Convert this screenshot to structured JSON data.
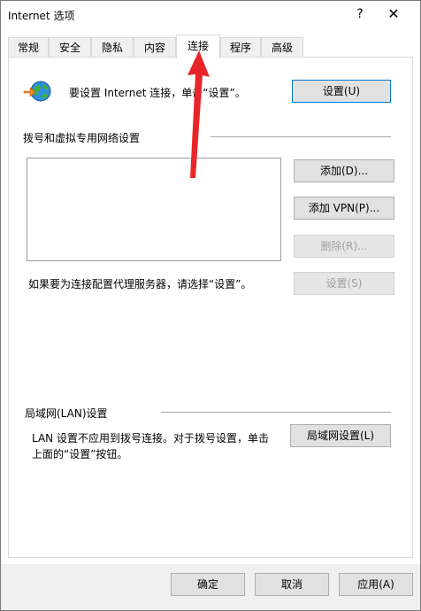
{
  "window": {
    "title": "Internet 选项",
    "help_glyph": "?",
    "close_glyph": "✕"
  },
  "tabs": [
    {
      "label": "常规"
    },
    {
      "label": "安全"
    },
    {
      "label": "隐私"
    },
    {
      "label": "内容"
    },
    {
      "label": "连接"
    },
    {
      "label": "程序"
    },
    {
      "label": "高级"
    }
  ],
  "active_tab": "连接",
  "setup": {
    "text": "要设置 Internet 连接，单击“设置”。",
    "button": "设置(U)"
  },
  "dialup": {
    "group_label": "拨号和虚拟专用网络设置",
    "add_button": "添加(D)...",
    "add_vpn_button": "添加 VPN(P)...",
    "remove_button": "删除(R)...",
    "proxy_text": "如果要为连接配置代理服务器，请选择“设置”。",
    "settings_button": "设置(S)"
  },
  "lan": {
    "group_label": "局域网(LAN)设置",
    "text_line1": "LAN 设置不应用到拨号连接。对于拨号设置，单击",
    "text_line2": "上面的“设置”按钮。",
    "button": "局域网设置(L)"
  },
  "footer": {
    "ok": "确定",
    "cancel": "取消",
    "apply": "应用(A)"
  },
  "colors": {
    "annotation_arrow": "#e8262a",
    "primary_border": "#0078d7"
  }
}
